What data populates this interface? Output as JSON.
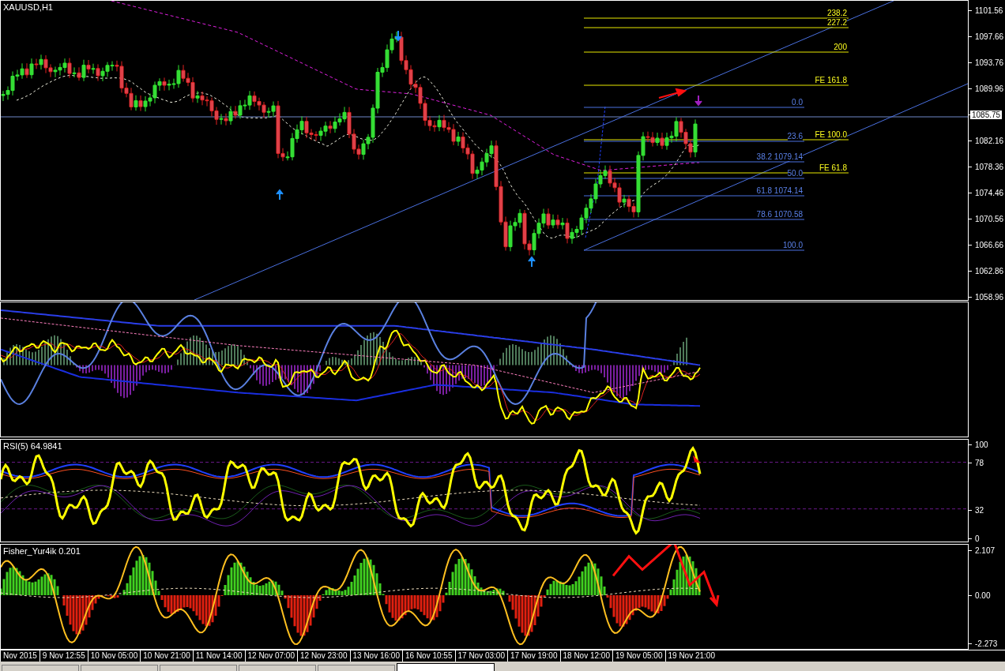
{
  "chart": {
    "symbol": "XAUUSD,H1",
    "price_axis": [
      {
        "kind": "tick",
        "label": "1101.56"
      },
      {
        "kind": "tick",
        "label": "1097.66"
      },
      {
        "kind": "tick",
        "label": "1093.76"
      },
      {
        "kind": "tick",
        "label": "1089.96"
      },
      {
        "kind": "current",
        "label": "1085.75"
      },
      {
        "kind": "tick",
        "label": "1082.16"
      },
      {
        "kind": "tick",
        "label": "1078.36"
      },
      {
        "kind": "tick",
        "label": "1074.46"
      },
      {
        "kind": "tick",
        "label": "1070.56"
      },
      {
        "kind": "tick",
        "label": "1066.66"
      },
      {
        "kind": "tick",
        "label": "1062.86"
      },
      {
        "kind": "tick",
        "label": "1058.96"
      }
    ],
    "fib_expansion": [
      "238.2",
      "227.2",
      "200",
      "FE 161.8",
      "FE 100.0",
      "FE 61.8"
    ],
    "fib_retracement": [
      "0.0",
      "23.6",
      "38.2 1079.14",
      "50.0",
      "61.8 1074.14",
      "78.6 1070.58",
      "100.0"
    ]
  },
  "rsi": {
    "title": "RSI(5) 64.9841",
    "axis": [
      "100",
      "78",
      "32",
      "0"
    ]
  },
  "fisher": {
    "title": "Fisher_Yur4ik 0.201",
    "axis": [
      "2.107",
      "0.00",
      "-2.273"
    ]
  },
  "time_axis": [
    "Nov 2015",
    "9 Nov 12:55",
    "10 Nov 05:00",
    "10 Nov 21:00",
    "11 Nov 14:00",
    "12 Nov 07:00",
    "12 Nov 23:00",
    "13 Nov 16:00",
    "16 Nov 10:55",
    "17 Nov 03:00",
    "17 Nov 19:00",
    "18 Nov 12:00",
    "19 Nov 05:00",
    "19 Nov 21:00"
  ],
  "tabs": [
    {
      "selected": false
    },
    {
      "selected": false
    },
    {
      "selected": false
    },
    {
      "selected": false
    },
    {
      "selected": false
    },
    {
      "selected": true
    }
  ]
}
